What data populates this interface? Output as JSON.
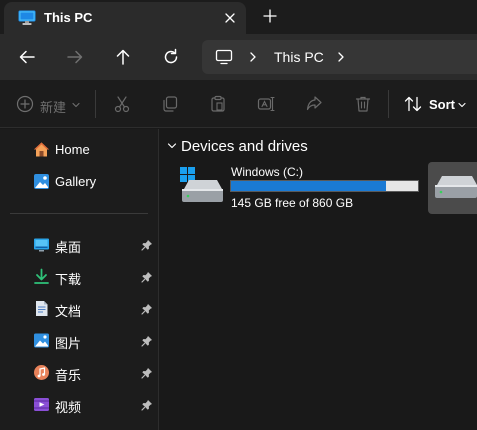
{
  "window": {
    "tab_title": "This PC",
    "tab_icon": "this-pc-icon"
  },
  "navigation": {
    "back": "back-arrow-icon",
    "forward": "forward-arrow-icon",
    "up": "up-arrow-icon",
    "refresh": "refresh-icon",
    "address": {
      "icon": "computer-icon",
      "path_label": "This PC"
    }
  },
  "command_bar": {
    "new_label": "新建",
    "actions": [
      "cut-icon",
      "copy-icon",
      "paste-icon",
      "rename-icon",
      "share-icon",
      "delete-icon"
    ],
    "sort_label": "Sort"
  },
  "sidebar": {
    "top_items": [
      {
        "label": "Home",
        "icon": "home-icon"
      },
      {
        "label": "Gallery",
        "icon": "gallery-icon"
      }
    ],
    "pinned_items": [
      {
        "label": "桌面",
        "icon": "desktop-folder-icon",
        "pinned": true
      },
      {
        "label": "下载",
        "icon": "downloads-icon",
        "pinned": true
      },
      {
        "label": "文档",
        "icon": "documents-icon",
        "pinned": true
      },
      {
        "label": "图片",
        "icon": "pictures-icon",
        "pinned": true
      },
      {
        "label": "音乐",
        "icon": "music-icon",
        "pinned": true
      },
      {
        "label": "视频",
        "icon": "videos-icon",
        "pinned": true
      }
    ]
  },
  "content": {
    "group_title": "Devices and drives",
    "drives": [
      {
        "name": "Windows (C:)",
        "free_text": "145 GB free of 860 GB",
        "used_fraction": 0.831
      },
      {
        "name": "",
        "free_text": "",
        "used_fraction": null
      }
    ]
  },
  "colors": {
    "accent": "#1a7ad4",
    "window_bg": "#191919",
    "tab_bg": "#2b2b2b",
    "muted_text": "#6f6f6f"
  }
}
